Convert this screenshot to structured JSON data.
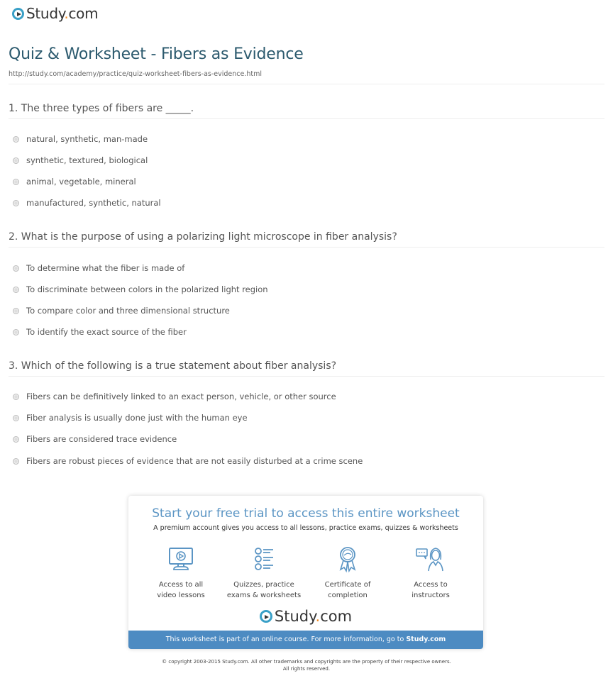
{
  "header": {
    "logo_text": "Study",
    "logo_dot": ".",
    "logo_suffix": "com",
    "title": "Quiz & Worksheet - Fibers as Evidence",
    "url": "http://study.com/academy/practice/quiz-worksheet-fibers-as-evidence.html"
  },
  "questions": [
    {
      "text": "1. The three types of fibers are _____.",
      "options": [
        "natural, synthetic, man-made",
        "synthetic, textured, biological",
        "animal, vegetable, mineral",
        "manufactured, synthetic, natural"
      ]
    },
    {
      "text": "2. What is the purpose of using a polarizing light microscope in fiber analysis?",
      "options": [
        "To determine what the fiber is made of",
        "To discriminate between colors in the polarized light region",
        "To compare color and three dimensional structure",
        "To identify the exact source of the fiber"
      ]
    },
    {
      "text": "3. Which of the following is a true statement about fiber analysis?",
      "options": [
        "Fibers can be definitively linked to an exact person, vehicle, or other source",
        "Fiber analysis is usually done just with the human eye",
        "Fibers are considered trace evidence",
        "Fibers are robust pieces of evidence that are not easily disturbed at a crime scene"
      ]
    }
  ],
  "promo": {
    "title": "Start your free trial to access this entire worksheet",
    "subtitle": "A premium account gives you access to all lessons, practice exams, quizzes & worksheets",
    "features": [
      {
        "icon": "video-monitor-icon",
        "line1": "Access to all",
        "line2": "video lessons"
      },
      {
        "icon": "quiz-list-icon",
        "line1": "Quizzes, practice",
        "line2": "exams & worksheets"
      },
      {
        "icon": "certificate-ribbon-icon",
        "line1": "Certificate of",
        "line2": "completion"
      },
      {
        "icon": "instructor-chat-icon",
        "line1": "Access to",
        "line2": "instructors"
      }
    ],
    "logo_text": "Study",
    "logo_dot": ".",
    "logo_suffix": "com",
    "bar_text": "This worksheet is part of an online course. For more information, go to ",
    "bar_link": "Study.com"
  },
  "footer": {
    "line1": "© copyright 2003-2015 Study.com. All other trademarks and copyrights are the property of their respective owners.",
    "line2": "All rights reserved."
  },
  "colors": {
    "title": "#2c5a6e",
    "accent_blue": "#4d8bc2",
    "logo_ring": "#3aa0c7",
    "logo_dot": "#f08a24"
  }
}
